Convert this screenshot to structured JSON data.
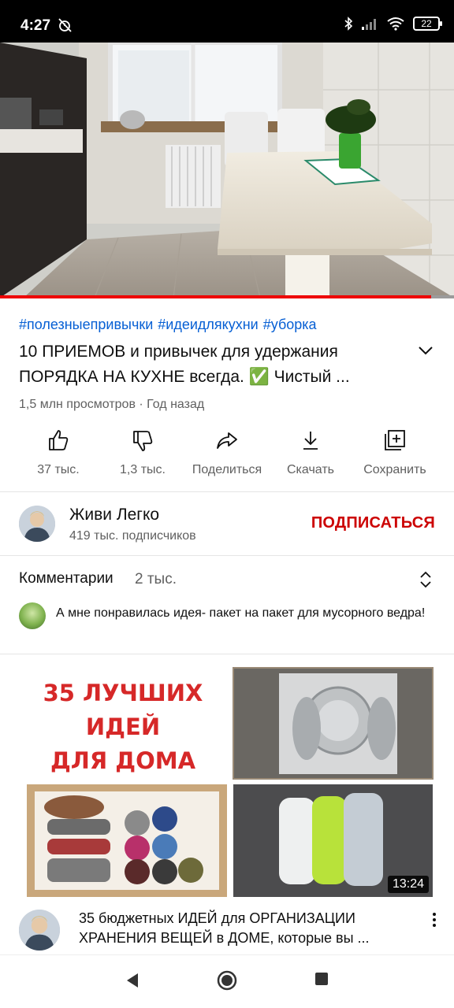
{
  "status_bar": {
    "time": "4:27",
    "battery": "22"
  },
  "video": {
    "progress_fraction": 0.95
  },
  "hashtags": [
    "#полезныепривычки",
    "#идеидлякухни",
    "#уборка"
  ],
  "title_lines": [
    "10 ПРИЕМОВ и привычек для удержания",
    "ПОРЯДКА НА КУХНЕ всегда. ✅ Чистый ..."
  ],
  "meta": "1,5 млн просмотров · Год назад",
  "actions": {
    "like": "37 тыс.",
    "dislike": "1,3 тыс.",
    "share": "Поделиться",
    "download": "Скачать",
    "save": "Сохранить"
  },
  "channel": {
    "name": "Живи Легко",
    "subscribers": "419 тыс. подписчиков",
    "subscribe_label": "ПОДПИСАТЬСЯ"
  },
  "comments": {
    "title": "Комментарии",
    "count": "2 тыс.",
    "top_comment": "А мне понравилась идея- пакет на пакет для мусорного ведра!"
  },
  "recommended": {
    "thumbnail_text": [
      "35 ЛУЧШИХ",
      "ИДЕЙ",
      "ДЛЯ ДОМА"
    ],
    "duration": "13:24",
    "title_lines": [
      "35 бюджетных ИДЕЙ для ОРГАНИЗАЦИИ",
      "ХРАНЕНИЯ ВЕЩЕЙ в ДОМЕ, которые вы ..."
    ]
  },
  "colors": {
    "accent_red": "#cc0000",
    "link_blue": "#065fd4",
    "progress_red": "#ee0000",
    "secondary_text": "#606060"
  }
}
